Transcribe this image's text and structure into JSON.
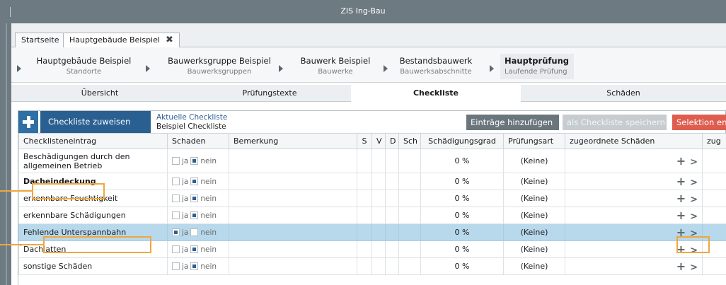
{
  "window": {
    "title": "ZIS Ing-Bau"
  },
  "tabs": [
    {
      "label": "Startseite"
    },
    {
      "label": "Hauptgebäude Beispiel",
      "close_icon": "close-icon"
    }
  ],
  "breadcrumb": [
    {
      "title": "Hauptgebäude Beispiel",
      "subtitle": "Standorte"
    },
    {
      "title": "Bauwerksgruppe Beispiel",
      "subtitle": "Bauwerksgruppen"
    },
    {
      "title": "Bauwerk Beispiel",
      "subtitle": "Bauwerke"
    },
    {
      "title": "Bestandsbauwerk",
      "subtitle": "Bauwerksabschnitte"
    },
    {
      "title": "Hauptprüfung",
      "subtitle": "Laufende Prüfung"
    }
  ],
  "subtabs": [
    "Übersicht",
    "Prüfungstexte",
    "Checkliste",
    "Schäden"
  ],
  "toolbar": {
    "assign_label": "Checkliste zuweisen",
    "current_label": "Aktuelle Checkliste",
    "current_value": "Beispiel Checkliste",
    "add_entries": "Einträge hinzufügen",
    "save_as": "als Checkliste speichern",
    "selection": "Selektion ent"
  },
  "columns": [
    "Checklisteneintrag",
    "Schaden",
    "Bemerkung",
    "S",
    "V",
    "D",
    "Sch",
    "Schädigungsgrad",
    "Prüfungsart",
    "zugeordnete Schäden",
    "zug"
  ],
  "yes_label": "ja",
  "no_label": "nein",
  "rows": [
    {
      "entry": "Beschädigungen durch den allgemeinen Betrieb",
      "bold": false,
      "yes": false,
      "no": true,
      "grade": "0 %",
      "type": "(Keine)",
      "selected": false
    },
    {
      "entry": "Dacheindeckung",
      "bold": true,
      "yes": false,
      "no": true,
      "grade": "0 %",
      "type": "(Keine)",
      "selected": false
    },
    {
      "entry": "erkennbare Feuchtigkeit",
      "bold": false,
      "yes": false,
      "no": true,
      "grade": "0 %",
      "type": "(Keine)",
      "selected": false
    },
    {
      "entry": "erkennbare Schädigungen",
      "bold": false,
      "yes": false,
      "no": true,
      "grade": "0 %",
      "type": "(Keine)",
      "selected": false
    },
    {
      "entry": "Fehlende Unterspannbahn",
      "bold": false,
      "yes": true,
      "no": false,
      "grade": "0 %",
      "type": "(Keine)",
      "selected": true
    },
    {
      "entry": "Dachlatten",
      "bold": false,
      "yes": false,
      "no": true,
      "grade": "0 %",
      "type": "(Keine)",
      "selected": false
    },
    {
      "entry": "sonstige Schäden",
      "bold": false,
      "yes": false,
      "no": true,
      "grade": "0 %",
      "type": "(Keine)",
      "selected": false
    }
  ],
  "colors": {
    "accent": "#2a5f91",
    "highlight": "#f0a73c",
    "selected_row": "#b8d8ec",
    "danger": "#de5d4f"
  }
}
